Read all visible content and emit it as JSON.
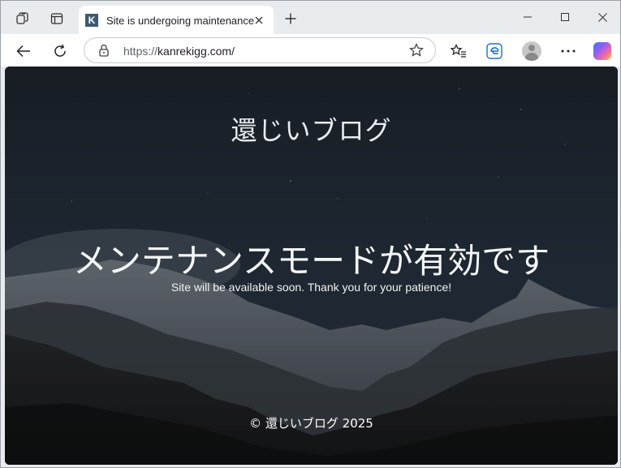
{
  "browser": {
    "tab": {
      "favicon_letter": "K",
      "title": "Site is undergoing maintenance"
    },
    "address": {
      "scheme": "https://",
      "host": "kanrekigg.com/"
    }
  },
  "page": {
    "site_title": "還じいブログ",
    "headline": "メンテナンスモードが有効です",
    "message": "Site will be available soon. Thank you for your patience!",
    "footer": "© 還じいブログ 2025"
  },
  "icons": {
    "workspaces": "workspaces-icon",
    "tab_actions": "tab-actions-icon",
    "close_tab": "close-icon",
    "new_tab": "plus-icon",
    "minimize": "minimize-icon",
    "maximize": "maximize-icon",
    "close_window": "close-window-icon",
    "back": "back-arrow-icon",
    "refresh": "refresh-icon",
    "lock": "lock-icon",
    "favorite": "star-icon",
    "favorites": "favorites-icon",
    "edge": "edge-icon",
    "profile": "avatar",
    "more": "more-icon",
    "copilot": "copilot-icon"
  },
  "colors": {
    "chrome_bg": "#e9ecef",
    "toolbar_bg": "#ffffff",
    "page_text": "#ffffff"
  }
}
